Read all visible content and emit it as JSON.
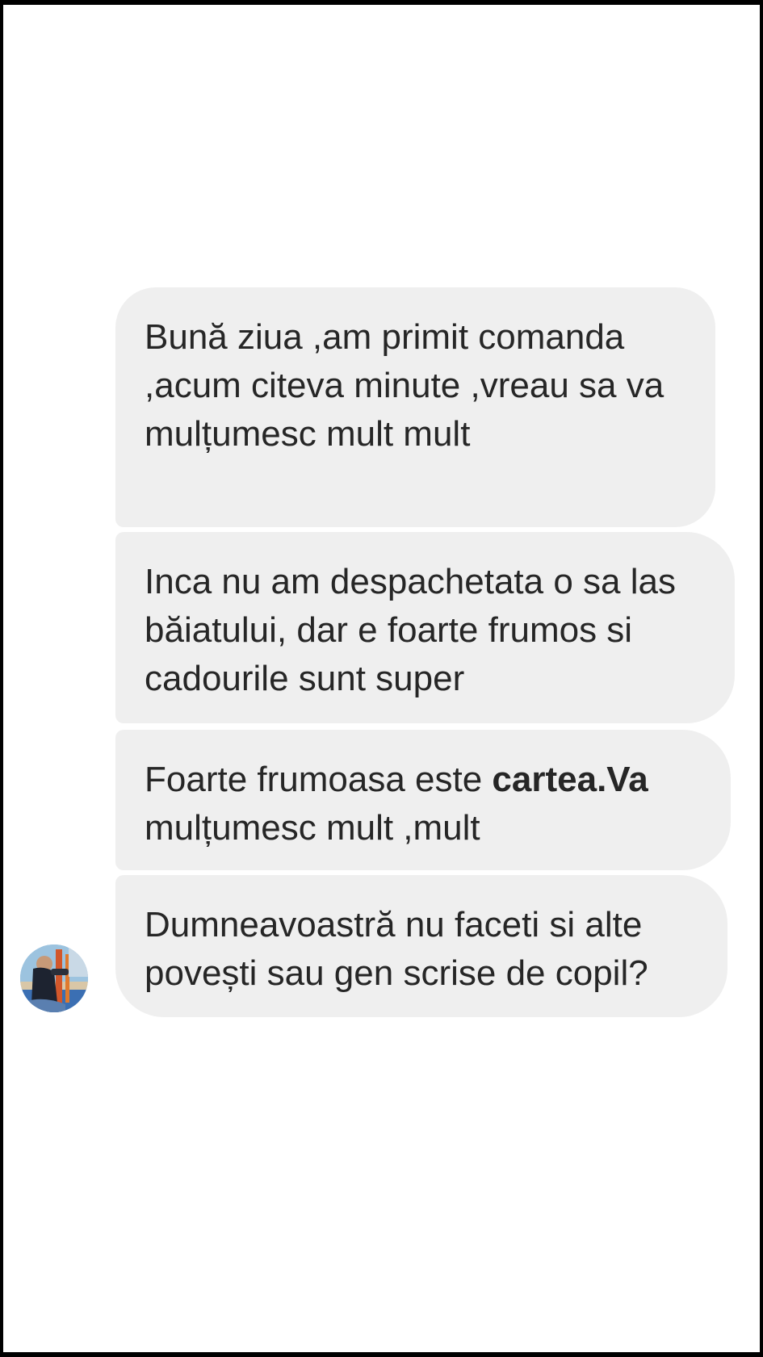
{
  "chat": {
    "messages": [
      {
        "text": "Bună ziua ,am primit comanda ,acum citeva minute ,vreau sa va mulțumesc mult mult"
      },
      {
        "text": "Inca nu am despachetata o sa las băiatului, dar e foarte frumos si cadourile sunt super"
      },
      {
        "text_before": "Foarte frumoasa este ",
        "text_bold": "cartea.Va",
        "text_after": " mulțumesc mult ,mult"
      },
      {
        "text": "Dumneavoastră nu faceti si alte povești sau gen scrise de copil?"
      }
    ],
    "sender_avatar": {
      "icon": "user-avatar-photo"
    }
  },
  "colors": {
    "bubble_background": "#efefef",
    "text": "#262626",
    "page_background": "#ffffff",
    "frame_border": "#000000"
  }
}
